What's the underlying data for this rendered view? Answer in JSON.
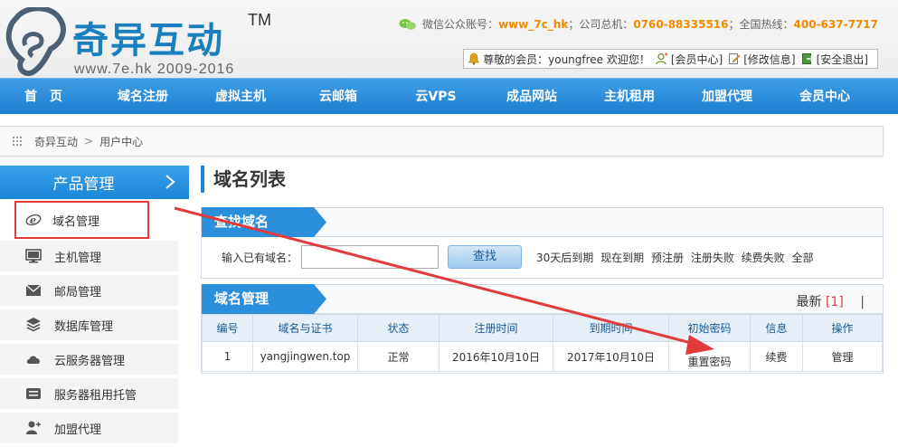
{
  "header": {
    "logo_text": "奇异互动",
    "logo_tm": "TM",
    "logo_sub": "www.7e.hk 2009-2016",
    "contact": {
      "wechat_label": "微信公众账号：",
      "wechat_value": "www_7c_hk",
      "hq_label": "；公司总机：",
      "hq_value": "0760-88335516",
      "hotline_label": "；全国热线：",
      "hotline_value": "400-637-7717"
    },
    "userbar": {
      "greeting": "尊敬的会员：youngfree  欢迎您！",
      "member_center": "[会员中心]",
      "edit_info": "[修改信息]",
      "logout": "[安全退出]"
    }
  },
  "nav": {
    "items": [
      "首　页",
      "域名注册",
      "虚拟主机",
      "云邮箱",
      "云VPS",
      "成品网站",
      "主机租用",
      "加盟代理",
      "会员中心"
    ]
  },
  "breadcrumb": {
    "home": "奇异互动",
    "sep": ">",
    "current": "用户中心"
  },
  "sidebar": {
    "title": "产品管理",
    "items": [
      {
        "label": "域名管理",
        "icon": "domain-e-icon"
      },
      {
        "label": "主机管理",
        "icon": "monitor-icon"
      },
      {
        "label": "邮局管理",
        "icon": "envelope-icon"
      },
      {
        "label": "数据库管理",
        "icon": "layers-icon"
      },
      {
        "label": "云服务器管理",
        "icon": "cloud-icon"
      },
      {
        "label": "服务器租用托管",
        "icon": "server-icon"
      },
      {
        "label": "加盟代理",
        "icon": "add-user-icon"
      }
    ]
  },
  "main": {
    "title": "域名列表",
    "search_panel": {
      "tab": "查找域名",
      "label": "输入已有域名：",
      "value": "",
      "button": "查找",
      "filters": [
        "30天后到期",
        "现在到期",
        "预注册",
        "注册失败",
        "续费失败",
        "全部"
      ]
    },
    "manage_panel": {
      "tab": "域名管理",
      "recent_label": "最新",
      "recent_count": "[1]",
      "recent_bar": "|",
      "columns": [
        "编号",
        "域名与证书",
        "状态",
        "注册时间",
        "到期时间",
        "初始密码",
        "信息",
        "操作"
      ],
      "rows": [
        {
          "id": "1",
          "domain": "yangjingwen.top",
          "status": "正常",
          "registered": "2016年10月10日",
          "expires": "2017年10月10日",
          "password": "重置密码",
          "info": "续费",
          "action": "管理"
        }
      ]
    }
  },
  "colors": {
    "brand_blue": "#1d86d8",
    "accent_orange": "#f28a00",
    "highlight_red": "#e23b3b"
  }
}
